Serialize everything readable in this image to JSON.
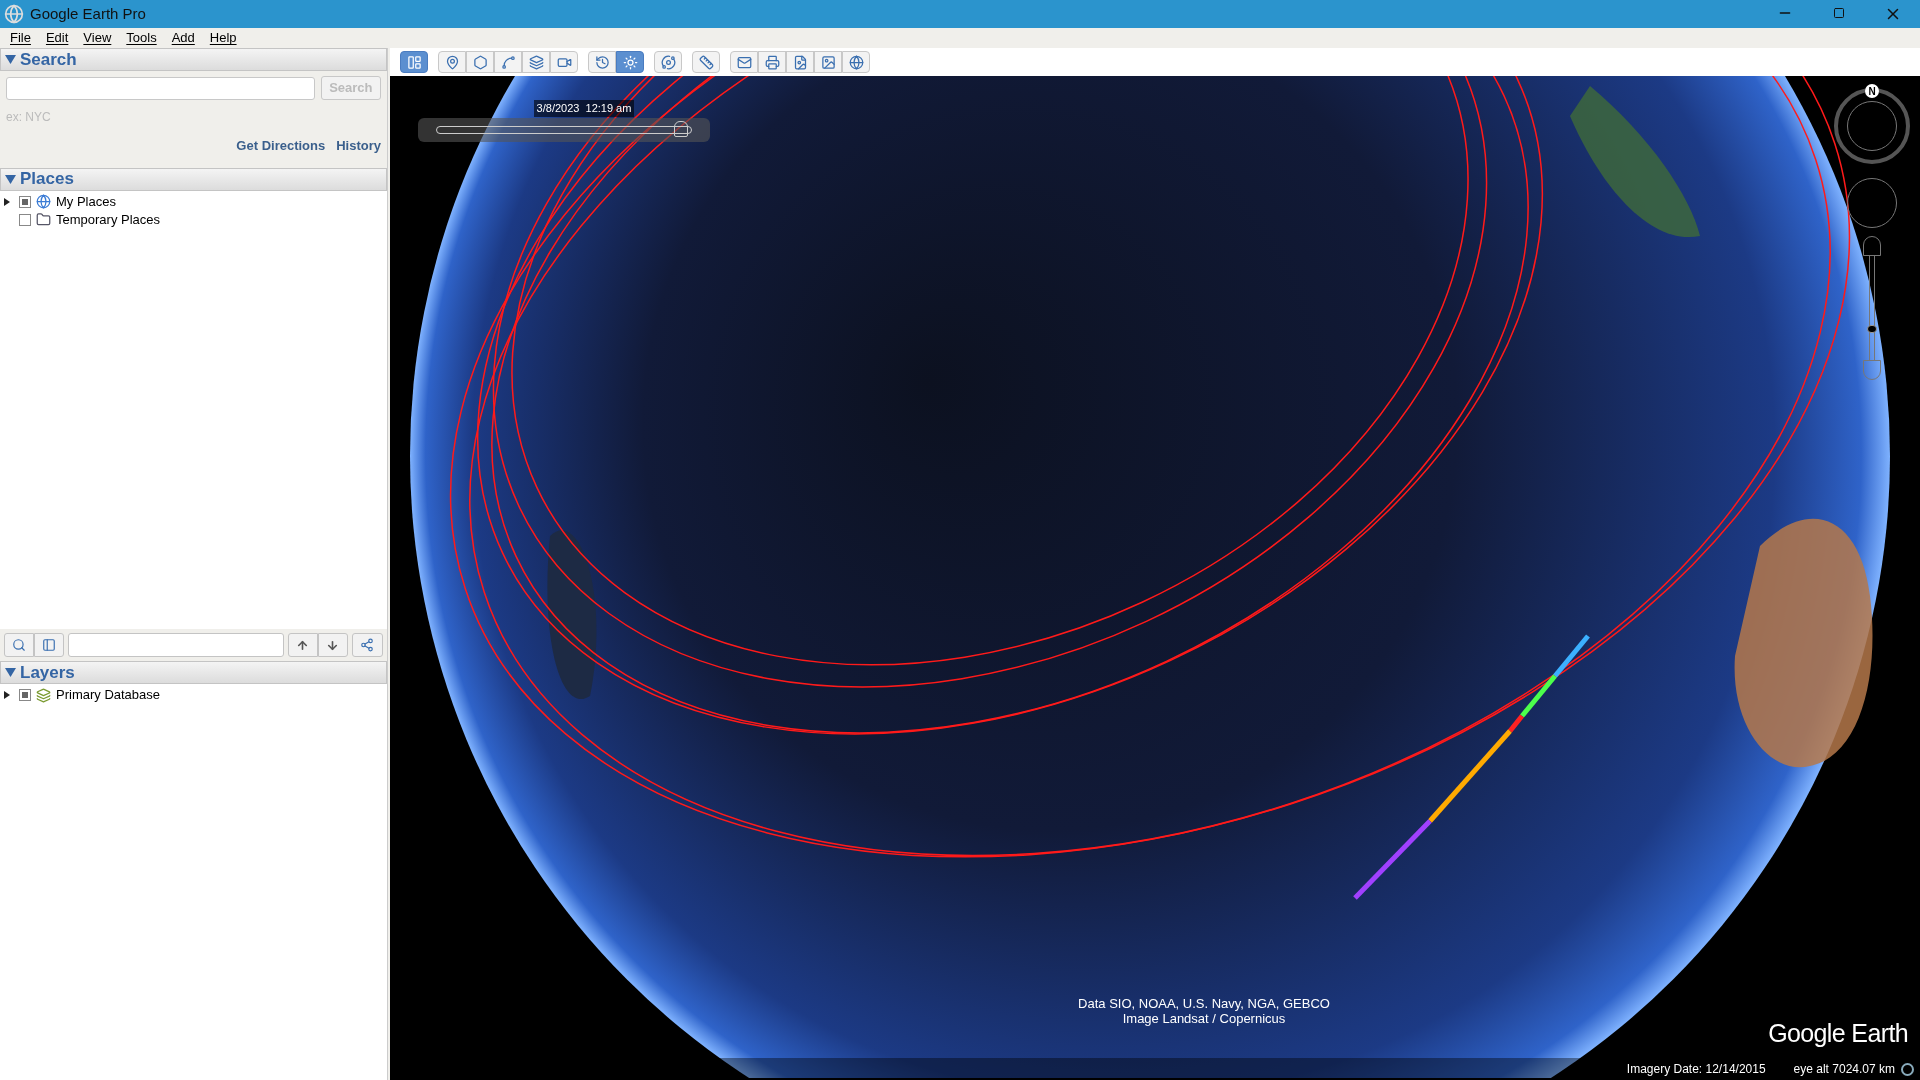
{
  "window": {
    "title": "Google Earth Pro"
  },
  "menu": [
    {
      "label": "File"
    },
    {
      "label": "Edit"
    },
    {
      "label": "View"
    },
    {
      "label": "Tools"
    },
    {
      "label": "Add"
    },
    {
      "label": "Help"
    }
  ],
  "search": {
    "title": "Search",
    "expanded": true,
    "button": "Search",
    "button_disabled": true,
    "hint": "ex: NYC",
    "links": [
      "Get Directions",
      "History"
    ]
  },
  "places": {
    "title": "Places",
    "expanded": true,
    "items": [
      {
        "label": "My Places",
        "kind": "globe",
        "checked": true,
        "expanded": false
      },
      {
        "label": "Temporary Places",
        "kind": "folder",
        "checked": false
      }
    ]
  },
  "layers": {
    "title": "Layers",
    "expanded": true,
    "items": [
      {
        "label": "Primary Database",
        "kind": "layers",
        "checked": true,
        "expanded": false
      }
    ]
  },
  "toolbar": [
    [
      {
        "kind": "sidebar",
        "selected": true
      }
    ],
    [
      {
        "kind": "placemark",
        "selected": false
      },
      {
        "kind": "polygon",
        "selected": false
      },
      {
        "kind": "path",
        "selected": false
      },
      {
        "kind": "overlay",
        "selected": false
      },
      {
        "kind": "tour",
        "selected": false
      }
    ],
    [
      {
        "kind": "history",
        "selected": false
      },
      {
        "kind": "sunlight",
        "selected": true
      }
    ],
    [
      {
        "kind": "planets",
        "selected": false
      }
    ],
    [
      {
        "kind": "ruler",
        "selected": false
      }
    ],
    [
      {
        "kind": "email",
        "selected": false
      },
      {
        "kind": "print",
        "selected": false
      },
      {
        "kind": "save-image",
        "selected": false
      },
      {
        "kind": "map-image",
        "selected": false
      },
      {
        "kind": "maps",
        "selected": false
      }
    ]
  ],
  "time_slider": {
    "date": "3/8/2023  12:19 am",
    "level": 0.96
  },
  "compass": {
    "north": "N"
  },
  "zoom_slider": {
    "level": 0.3
  },
  "attribution": [
    "Data SIO, NOAA, U.S. Navy, NGA, GEBCO",
    "Image Landsat / Copernicus"
  ],
  "logo": "Google Earth",
  "status_bar": {
    "imagery_date": "Imagery Date: 12/14/2015",
    "eye_alt": "eye alt 7024.07 km"
  }
}
